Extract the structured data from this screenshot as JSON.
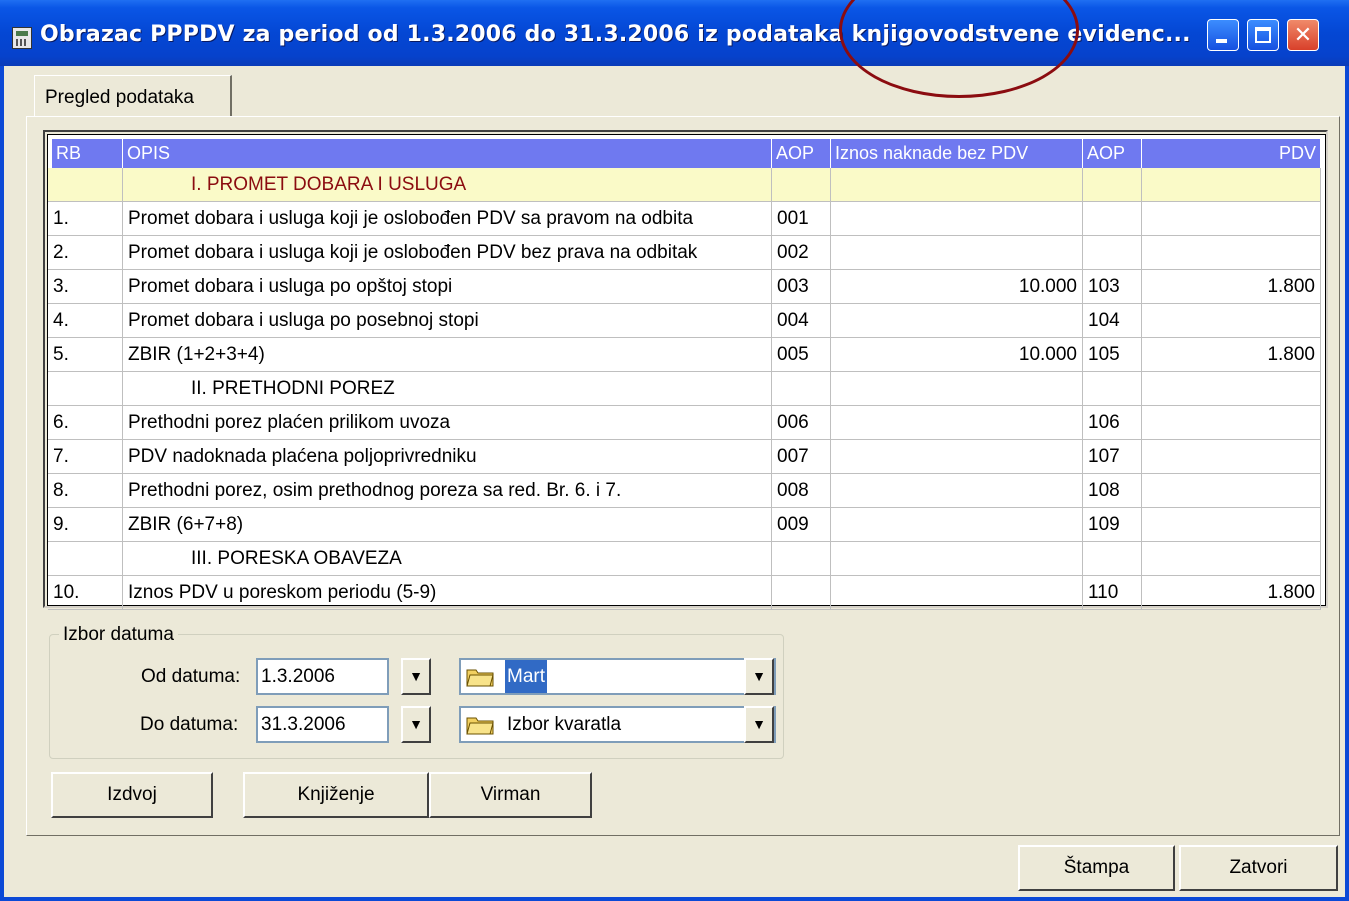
{
  "window": {
    "title": "Obrazac PPPDV za period od 1.3.2006 do 31.3.2006 iz podataka knjigovodstvene evidenc..."
  },
  "tab": {
    "label": "Pregled podataka"
  },
  "table": {
    "headers": [
      "RB",
      "OPIS",
      "AOP",
      "Iznos naknade bez PDV",
      "AOP",
      "PDV"
    ],
    "rows": [
      {
        "rb": "",
        "opis": "I. PROMET DOBARA I USLUGA",
        "aop1": "",
        "iznos": "",
        "aop2": "",
        "pdv": ""
      },
      {
        "rb": "1.",
        "opis": "Promet dobara i usluga koji je oslobođen PDV sa pravom na odbita",
        "aop1": "001",
        "iznos": "",
        "aop2": "",
        "pdv": ""
      },
      {
        "rb": "2.",
        "opis": "Promet dobara i usluga koji je oslobođen PDV bez prava na odbitak",
        "aop1": "002",
        "iznos": "",
        "aop2": "",
        "pdv": ""
      },
      {
        "rb": "3.",
        "opis": "Promet dobara i usluga po opštoj stopi",
        "aop1": "003",
        "iznos": "10.000",
        "aop2": "103",
        "pdv": "1.800"
      },
      {
        "rb": "4.",
        "opis": "Promet dobara i usluga po posebnoj stopi",
        "aop1": "004",
        "iznos": "",
        "aop2": "104",
        "pdv": ""
      },
      {
        "rb": "5.",
        "opis": "ZBIR (1+2+3+4)",
        "aop1": "005",
        "iznos": "10.000",
        "aop2": "105",
        "pdv": "1.800"
      },
      {
        "rb": "",
        "opis": "II. PRETHODNI POREZ",
        "aop1": "",
        "iznos": "",
        "aop2": "",
        "pdv": ""
      },
      {
        "rb": "6.",
        "opis": "Prethodni porez plaćen prilikom uvoza",
        "aop1": "006",
        "iznos": "",
        "aop2": "106",
        "pdv": ""
      },
      {
        "rb": "7.",
        "opis": "PDV nadoknada plaćena poljoprivredniku",
        "aop1": "007",
        "iznos": "",
        "aop2": "107",
        "pdv": ""
      },
      {
        "rb": "8.",
        "opis": "Prethodni porez, osim prethodnog poreza sa red. Br. 6. i 7.",
        "aop1": "008",
        "iznos": "",
        "aop2": "108",
        "pdv": ""
      },
      {
        "rb": "9.",
        "opis": "ZBIR (6+7+8)",
        "aop1": "009",
        "iznos": "",
        "aop2": "109",
        "pdv": ""
      },
      {
        "rb": "",
        "opis": "III. PORESKA OBAVEZA",
        "aop1": "",
        "iznos": "",
        "aop2": "",
        "pdv": ""
      },
      {
        "rb": "10.",
        "opis": "Iznos PDV u poreskom periodu (5-9)",
        "aop1": "",
        "iznos": "",
        "aop2": "110",
        "pdv": "1.800"
      }
    ]
  },
  "date_group": {
    "label": "Izbor datuma",
    "od_label": "Od datuma:",
    "od_value": "1.3.2006",
    "do_label": "Do datuma:",
    "do_value": "31.3.2006",
    "month_value": "Mart",
    "quarter_value": "Izbor kvaratla"
  },
  "buttons": {
    "izdvoj": "Izdvoj",
    "knjizenje": "Knjiženje",
    "virman": "Virman",
    "stampa": "Štampa",
    "zatvori": "Zatvori"
  },
  "colors": {
    "header_bg": "#6f79f0",
    "section_highlight": "#fafac8",
    "section_text_red": "#8b0c10",
    "annotation": "#8b0c10"
  }
}
